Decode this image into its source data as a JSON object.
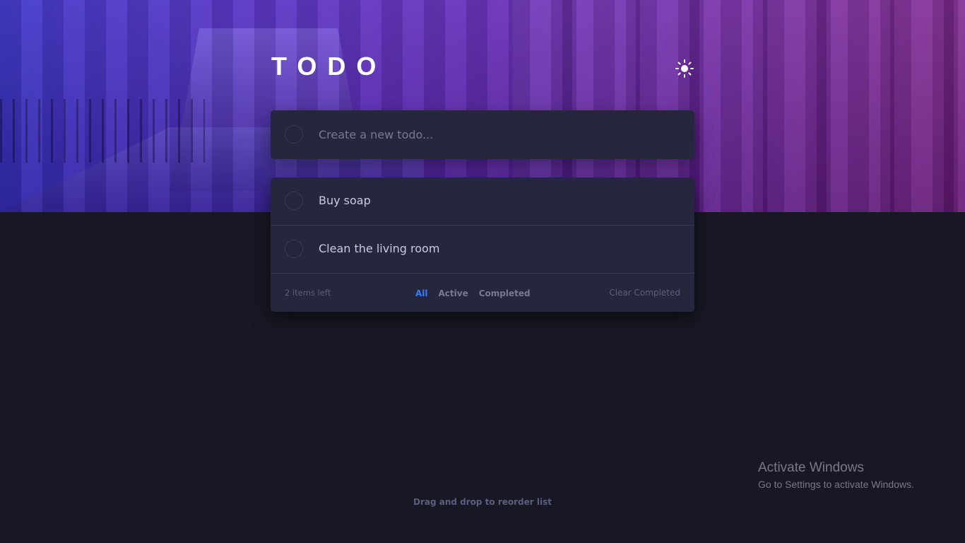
{
  "header": {
    "title": "TODO",
    "theme_toggle_icon": "sun-icon"
  },
  "new_todo": {
    "placeholder": "Create a new todo..."
  },
  "todos": [
    {
      "text": "Buy soap",
      "completed": false
    },
    {
      "text": "Clean the living room",
      "completed": false
    }
  ],
  "footer": {
    "items_left": "2 items left",
    "filters": [
      {
        "label": "All",
        "active": true
      },
      {
        "label": "Active",
        "active": false
      },
      {
        "label": "Completed",
        "active": false
      }
    ],
    "clear_label": "Clear Completed"
  },
  "drag_hint": "Drag and drop to reorder list",
  "watermark": {
    "title": "Activate Windows",
    "subtitle": "Go to Settings to activate Windows."
  },
  "colors": {
    "page_bg": "#181824",
    "card_bg": "#25273c",
    "accent": "#3a7cfd",
    "text": "#c8cbe7",
    "muted": "#5b5e7e"
  }
}
